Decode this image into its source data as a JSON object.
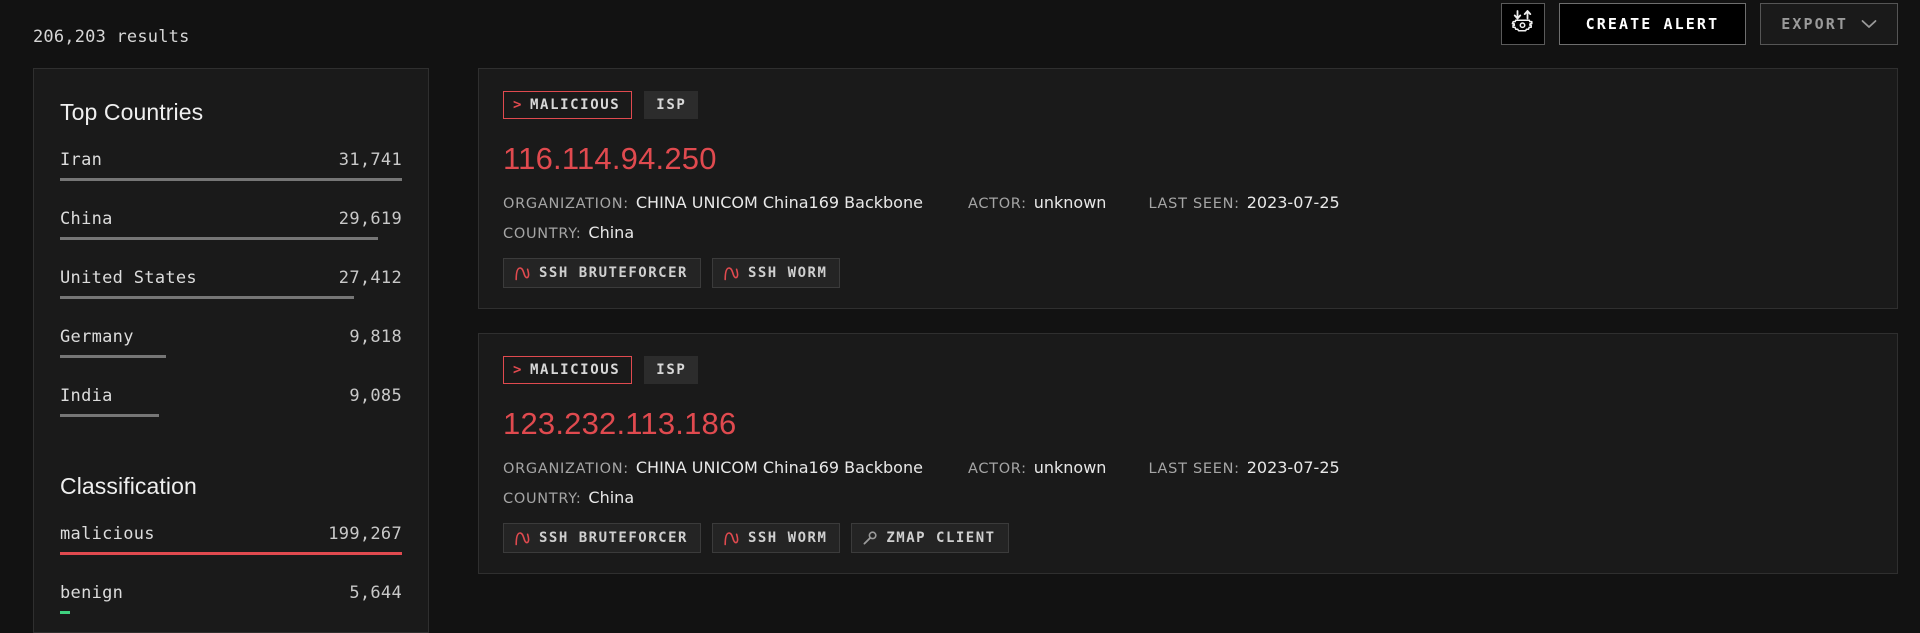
{
  "topbar": {
    "results_count": "206,203 results",
    "settings_icon": "import-export-gear-icon",
    "create_alert_label": "CREATE ALERT",
    "export_label": "EXPORT",
    "export_chevron_icon": "chevron-down-icon"
  },
  "sidebar": {
    "facets": [
      {
        "title": "Top Countries",
        "rows": [
          {
            "label": "Iran",
            "value": "31,741",
            "bar_pct": 100,
            "bar_color": "#767676"
          },
          {
            "label": "China",
            "value": "29,619",
            "bar_pct": 93,
            "bar_color": "#767676"
          },
          {
            "label": "United States",
            "value": "27,412",
            "bar_pct": 86,
            "bar_color": "#767676"
          },
          {
            "label": "Germany",
            "value": "9,818",
            "bar_pct": 31,
            "bar_color": "#767676"
          },
          {
            "label": "India",
            "value": "9,085",
            "bar_pct": 29,
            "bar_color": "#767676"
          }
        ]
      },
      {
        "title": "Classification",
        "rows": [
          {
            "label": "malicious",
            "value": "199,267",
            "bar_pct": 100,
            "bar_color": "#e04a4f"
          },
          {
            "label": "benign",
            "value": "5,644",
            "bar_pct": 3,
            "bar_color": "#3fd17f"
          }
        ]
      }
    ]
  },
  "results": [
    {
      "classification_badge": "MALICIOUS",
      "chevron": ">",
      "type_badge": "ISP",
      "ip": "116.114.94.250",
      "organization_key": "ORGANIZATION:",
      "organization_value": "CHINA UNICOM China169 Backbone",
      "actor_key": "ACTOR:",
      "actor_value": "unknown",
      "last_seen_key": "LAST SEEN:",
      "last_seen_value": "2023-07-25",
      "country_key": "COUNTRY:",
      "country_value": "China",
      "tags": [
        {
          "label": "SSH BRUTEFORCER",
          "icon": "worm-icon",
          "icon_color": "#e04a4f"
        },
        {
          "label": "SSH WORM",
          "icon": "worm-icon",
          "icon_color": "#e04a4f"
        }
      ]
    },
    {
      "classification_badge": "MALICIOUS",
      "chevron": ">",
      "type_badge": "ISP",
      "ip": "123.232.113.186",
      "organization_key": "ORGANIZATION:",
      "organization_value": "CHINA UNICOM China169 Backbone",
      "actor_key": "ACTOR:",
      "actor_value": "unknown",
      "last_seen_key": "LAST SEEN:",
      "last_seen_value": "2023-07-25",
      "country_key": "COUNTRY:",
      "country_value": "China",
      "tags": [
        {
          "label": "SSH BRUTEFORCER",
          "icon": "worm-icon",
          "icon_color": "#e04a4f"
        },
        {
          "label": "SSH WORM",
          "icon": "worm-icon",
          "icon_color": "#e04a4f"
        },
        {
          "label": "ZMAP CLIENT",
          "icon": "magnifier-icon",
          "icon_color": "#9a9a9a"
        }
      ]
    }
  ],
  "colors": {
    "background": "#121212",
    "panel": "#1a1a1a",
    "border": "#2f2f2f",
    "malicious": "#e04a4f",
    "benign": "#3fd17f",
    "text": "#e8e8e8",
    "muted": "#a5a5a5"
  }
}
